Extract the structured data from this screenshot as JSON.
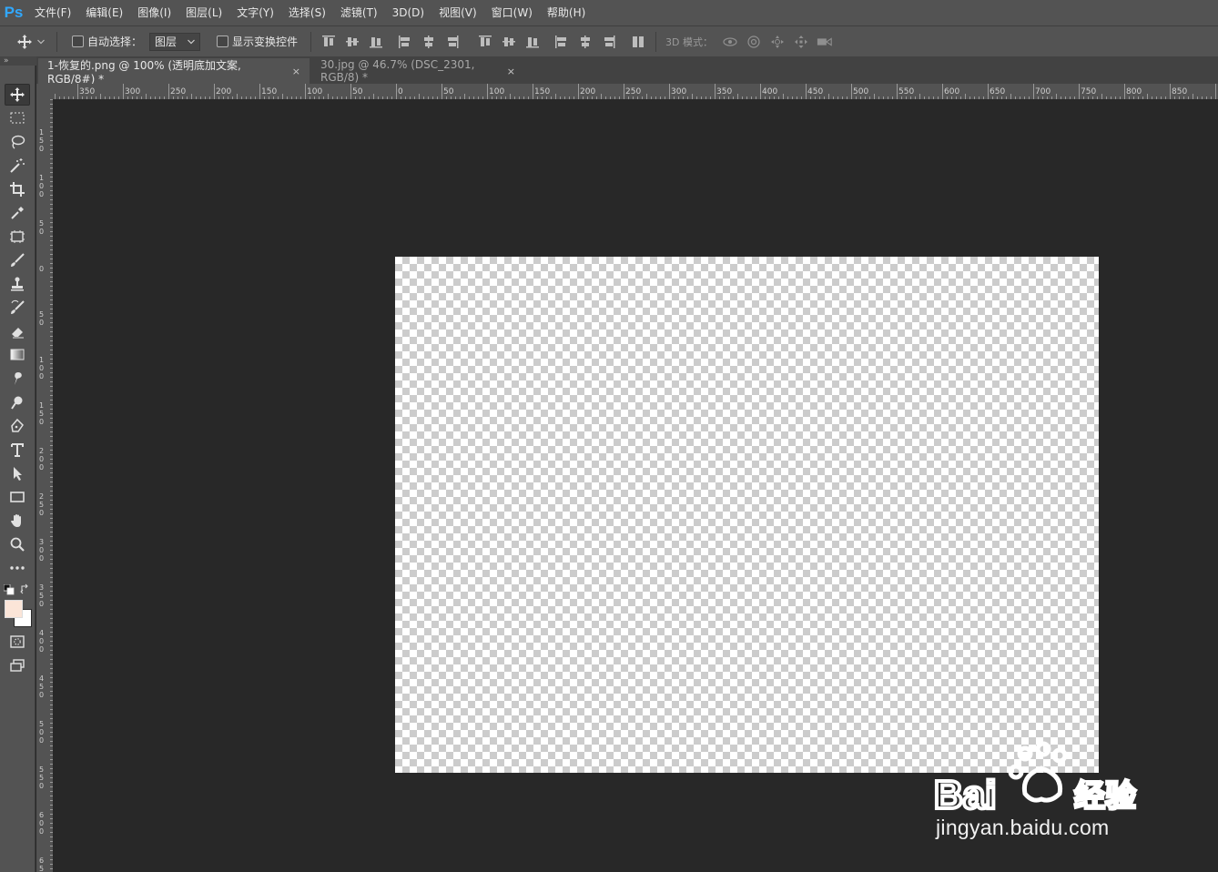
{
  "app": {
    "logo": "Ps"
  },
  "menu": [
    "文件(F)",
    "编辑(E)",
    "图像(I)",
    "图层(L)",
    "文字(Y)",
    "选择(S)",
    "滤镜(T)",
    "3D(D)",
    "视图(V)",
    "窗口(W)",
    "帮助(H)"
  ],
  "options": {
    "auto_select_label": "自动选择：",
    "auto_select_checked": false,
    "auto_select_target": "图层",
    "show_transform_label": "显示变换控件",
    "show_transform_checked": false,
    "mode_3d_label": "3D 模式："
  },
  "panel": {
    "collapse_glyph": "»"
  },
  "tabs": [
    {
      "title": "1-恢复的.png @ 100% (透明底加文案, RGB/8#) *",
      "close": "×",
      "active": true
    },
    {
      "title": "30.jpg @ 46.7% (DSC_2301, RGB/8) *",
      "close": "×",
      "active": false
    }
  ],
  "ruler": {
    "h_labels": [
      "350",
      "300",
      "250",
      "200",
      "150",
      "100",
      "50",
      "0",
      "50",
      "100",
      "150",
      "200",
      "250",
      "300",
      "350",
      "400",
      "450",
      "500",
      "550",
      "600",
      "650",
      "700",
      "750",
      "800",
      "850"
    ],
    "v_labels": [
      "150",
      "100",
      "50",
      "0",
      "50",
      "100",
      "150",
      "200",
      "250",
      "300",
      "350",
      "400",
      "450",
      "500",
      "550",
      "600",
      "650"
    ]
  },
  "tools": [
    "move-tool-icon",
    "marquee-tool-icon",
    "lasso-tool-icon",
    "magic-wand-tool-icon",
    "crop-tool-icon",
    "eyedropper-tool-icon",
    "frame-tool-icon",
    "brush-tool-icon",
    "stamp-tool-icon",
    "history-brush-tool-icon",
    "eraser-tool-icon",
    "gradient-tool-icon",
    "smudge-tool-icon",
    "dodge-tool-icon",
    "pen-tool-icon",
    "type-tool-icon",
    "path-selection-tool-icon",
    "rectangle-tool-icon",
    "hand-tool-icon",
    "zoom-tool-icon",
    "more-tools-icon"
  ],
  "colors": {
    "foreground": "#fbe5d8",
    "background": "#ffffff",
    "accent": "#31a8ff"
  },
  "watermark": {
    "brand": "Bai",
    "suffix": "经验",
    "url": "jingyan.baidu.com"
  }
}
